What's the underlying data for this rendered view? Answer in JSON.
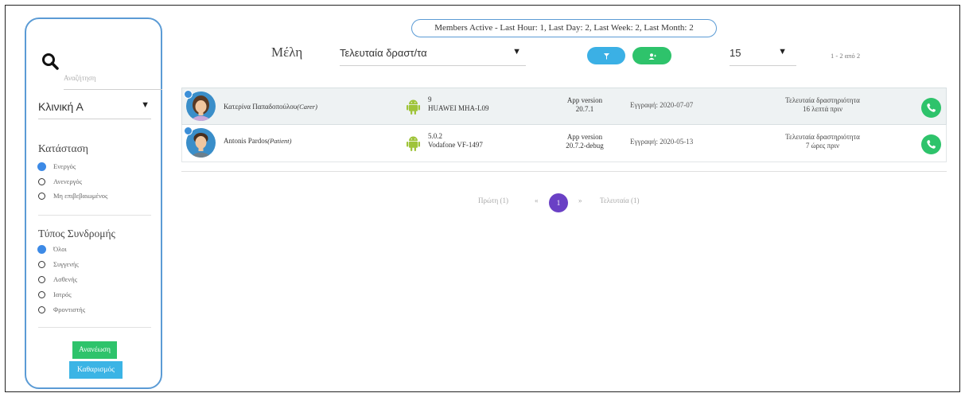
{
  "sidebar": {
    "search_placeholder": "Αναζήτηση",
    "clinic": {
      "selected": "Κλινική Α"
    },
    "status": {
      "title": "Κατάσταση",
      "options": [
        {
          "label": "Ενεργός",
          "checked": true
        },
        {
          "label": "Ανενεργός",
          "checked": false
        },
        {
          "label": "Μη επιβεβαιωμένος",
          "checked": false
        }
      ]
    },
    "subscription": {
      "title": "Τύπος Συνδρομής",
      "options": [
        {
          "label": "Όλοι",
          "checked": true
        },
        {
          "label": "Συγγενής",
          "checked": false
        },
        {
          "label": "Ασθενής",
          "checked": false
        },
        {
          "label": "Ιατρός",
          "checked": false
        },
        {
          "label": "Φροντιστής",
          "checked": false
        }
      ]
    },
    "refresh_label": "Ανανέωση",
    "clear_label": "Καθαρισμός"
  },
  "header": {
    "active_summary": "Members Active - Last Hour: 1, Last Day: 2, Last Week: 2, Last Month: 2",
    "title": "Μέλη",
    "sort_selected": "Τελευταία δραστ/τα",
    "per_page": "15",
    "range": "1 - 2 από 2"
  },
  "members": [
    {
      "name": "Κατερίνα Παπαδοπούλου",
      "role": "(Carer)",
      "os_version": "9",
      "device": "HUAWEI MHA-L09",
      "app_version_label": "App version",
      "app_version": "20.7.1",
      "registration": "Εγγραφή: 2020-07-07",
      "last_activity_label": "Τελευταία δραστηριότητα",
      "last_activity": "16 λεπτά πριν"
    },
    {
      "name": "Antonis Pardos",
      "role": "(Patient)",
      "os_version": "5.0.2",
      "device": "Vodafone VF-1497",
      "app_version_label": "App version",
      "app_version": "20.7.2-debug",
      "registration": "Εγγραφή: 2020-05-13",
      "last_activity_label": "Τελευταία δραστηριότητα",
      "last_activity": "7 ώρες πριν"
    }
  ],
  "pagination": {
    "first": "Πρώτη (1)",
    "prev": "«",
    "current": "1",
    "next": "»",
    "last": "Τελευταία (1)"
  },
  "colors": {
    "accent_blue": "#5b9bd5",
    "green": "#2ec36b",
    "light_blue": "#3bb0e5",
    "purple": "#6a40c5"
  }
}
